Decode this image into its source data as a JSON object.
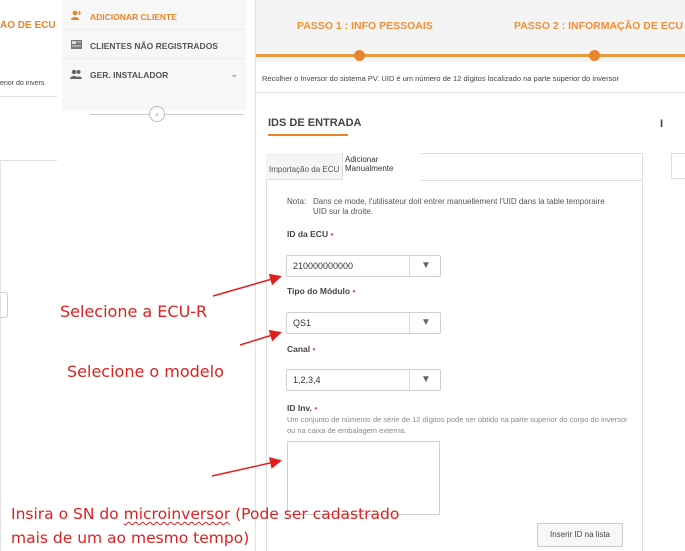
{
  "left_strip": {
    "ecu_tab_fragment": "ÃO DE ECU",
    "hint_fragment": "erior do invers"
  },
  "sidebar": {
    "items": [
      {
        "label": "ADICIONAR CLIENTE",
        "icon": "add-user-icon",
        "active": true
      },
      {
        "label": "CLIENTES NÃO REGISTRADOS",
        "icon": "list-card-icon",
        "active": false
      },
      {
        "label": "GER. INSTALADOR",
        "icon": "users-icon",
        "active": false
      }
    ]
  },
  "steps": {
    "step1": "PASSO 1 : INFO PESSOAIS",
    "step2": "PASSO 2 : INFORMAÇÃO DE ECU"
  },
  "instruction": "Recolher o Inversor do sistema PV. UID é um número de 12 dígitos localizado na parte superior do inversor",
  "section": {
    "title": "IDS DE ENTRADA",
    "right_fragment": "I"
  },
  "tabs": {
    "import_ecu": "Importação da ECU",
    "manual_line1": "Adicionar",
    "manual_line2": "Manualmente"
  },
  "note": {
    "label": "Nota:",
    "text": "Dans ce mode, l'utilisateur doit entrer manuellement l'UID dans la table temporaire UID sur la droite."
  },
  "form": {
    "ecu_id": {
      "label": "ID da ECU",
      "required": "•",
      "value": "210000000000"
    },
    "module_type": {
      "label": "Tipo do Módulo",
      "required": "•",
      "value": "QS1"
    },
    "channel": {
      "label": "Canal",
      "required": "•",
      "value": "1,2,3,4"
    },
    "inv_id": {
      "label": "ID Inv.",
      "required": "•",
      "hint": "Um conjunto de números de série de 12 dígitos pode ser obtido na parte superior do corpo do inversor ou na caixa de embalagem externa.",
      "value": ""
    },
    "insert_button": "Inserir ID na lista"
  },
  "annotations": {
    "select_ecu": "Selecione a ECU-R",
    "select_model": "Selecione o modelo",
    "insert_sn_before": "Insira o SN do ",
    "insert_sn_squiggle": "microinversor",
    "insert_sn_after": " (Pode ser cadastrado mais de um ao mesmo tempo)"
  },
  "colors": {
    "accent": "#e8852a",
    "annotation_red": "#e02020"
  }
}
